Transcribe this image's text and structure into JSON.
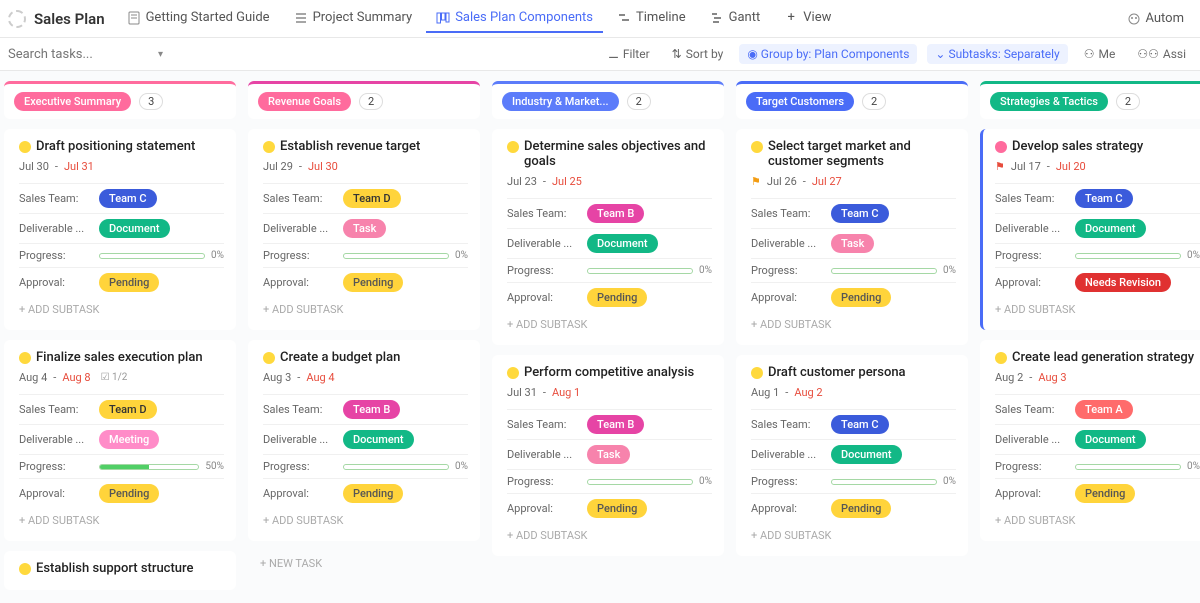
{
  "header": {
    "title": "Sales Plan",
    "tabs": [
      {
        "label": "Getting Started Guide",
        "icon": "doc"
      },
      {
        "label": "Project Summary",
        "icon": "list"
      },
      {
        "label": "Sales Plan Components",
        "icon": "board",
        "active": true
      },
      {
        "label": "Timeline",
        "icon": "timeline"
      },
      {
        "label": "Gantt",
        "icon": "gantt"
      },
      {
        "label": "View",
        "icon": "plus"
      }
    ],
    "automations": "Autom"
  },
  "toolbar": {
    "search_placeholder": "Search tasks...",
    "filter": "Filter",
    "sort": "Sort by",
    "group": "Group by: Plan Components",
    "subtasks": "Subtasks: Separately",
    "me": "Me",
    "assign": "Assi"
  },
  "columns": [
    {
      "name": "Executive Summary",
      "count": "3",
      "color": "#ff6b9d",
      "top": "#ff6b9d"
    },
    {
      "name": "Revenue Goals",
      "count": "2",
      "color": "#ff6b9d",
      "top": "#e644a5"
    },
    {
      "name": "Industry & Market...",
      "count": "2",
      "color": "#5c7cfa",
      "top": "#5c7cfa"
    },
    {
      "name": "Target Customers",
      "count": "2",
      "color": "#4a6cf7",
      "top": "#4a6cf7"
    },
    {
      "name": "Strategies & Tactics",
      "count": "2",
      "color": "#12b886",
      "top": "#12b886"
    }
  ],
  "cards": {
    "c0": [
      {
        "title": "Draft positioning statement",
        "dot": "yellow",
        "d1": "Jul 30",
        "d2": "Jul 31",
        "team": "Team C",
        "teamc": "teamc",
        "deliv": "Document",
        "delivc": "doc",
        "prog": 0,
        "appr": "Pending",
        "apprc": "pend"
      },
      {
        "title": "Finalize sales execution plan",
        "dot": "yellow",
        "d1": "Aug 4",
        "d2": "Aug 8",
        "chk": "1/2",
        "team": "Team D",
        "teamc": "teamd",
        "deliv": "Meeting",
        "delivc": "meet",
        "prog": 50,
        "appr": "Pending",
        "apprc": "pend"
      },
      {
        "title": "Establish support structure",
        "dot": "yellow",
        "newcard": true
      }
    ],
    "c1": [
      {
        "title": "Establish revenue target",
        "dot": "yellow",
        "d1": "Jul 29",
        "d2": "Jul 30",
        "team": "Team D",
        "teamc": "teamd",
        "deliv": "Task",
        "delivc": "task",
        "prog": 0,
        "appr": "Pending",
        "apprc": "pend"
      },
      {
        "title": "Create a budget plan",
        "dot": "yellow",
        "d1": "Aug 3",
        "d2": "Aug 4",
        "team": "Team B",
        "teamc": "teamb",
        "deliv": "Document",
        "delivc": "doc",
        "prog": 0,
        "appr": "Pending",
        "apprc": "pend"
      }
    ],
    "c2": [
      {
        "title": "Determine sales objectives and goals",
        "dot": "yellow",
        "d1": "Jul 23",
        "d2": "Jul 25",
        "team": "Team B",
        "teamc": "teamb",
        "deliv": "Document",
        "delivc": "doc",
        "prog": 0,
        "appr": "Pending",
        "apprc": "pend"
      },
      {
        "title": "Perform competitive analysis",
        "dot": "yellow",
        "d1": "Jul 31",
        "d2": "Aug 1",
        "team": "Team B",
        "teamc": "teamb",
        "deliv": "Task",
        "delivc": "task",
        "prog": 0,
        "appr": "Pending",
        "apprc": "pend"
      }
    ],
    "c3": [
      {
        "title": "Select target market and customer segments",
        "dot": "yellow",
        "flag": "orange",
        "d1": "Jul 26",
        "d2": "Jul 27",
        "team": "Team C",
        "teamc": "teamc",
        "deliv": "Task",
        "delivc": "task",
        "prog": 0,
        "appr": "Pending",
        "apprc": "pend"
      },
      {
        "title": "Draft customer persona",
        "dot": "yellow",
        "d1": "Aug 1",
        "d2": "Aug 2",
        "team": "Team C",
        "teamc": "teamc",
        "deliv": "Document",
        "delivc": "doc",
        "prog": 0,
        "appr": "Pending",
        "apprc": "pend"
      }
    ],
    "c4": [
      {
        "title": "Develop sales strategy",
        "dot": "pink",
        "flag": "red",
        "d1": "Jul 17",
        "d2": "Jul 20",
        "team": "Team C",
        "teamc": "teamc",
        "deliv": "Document",
        "delivc": "doc",
        "prog": 0,
        "appr": "Needs Revision",
        "apprc": "rev",
        "flagged": true
      },
      {
        "title": "Create lead generation strategy",
        "dot": "yellow",
        "d1": "Aug 2",
        "d2": "Aug 3",
        "team": "Team A",
        "teamc": "teama",
        "deliv": "Document",
        "delivc": "doc",
        "prog": 0,
        "appr": "Pending",
        "apprc": "pend"
      }
    ]
  },
  "labels": {
    "sales_team": "Sales Team:",
    "deliverable": "Deliverable ...",
    "progress": "Progress:",
    "approval": "Approval:",
    "add_subtask": "+ ADD SUBTASK",
    "new_task": "+ NEW TASK"
  }
}
